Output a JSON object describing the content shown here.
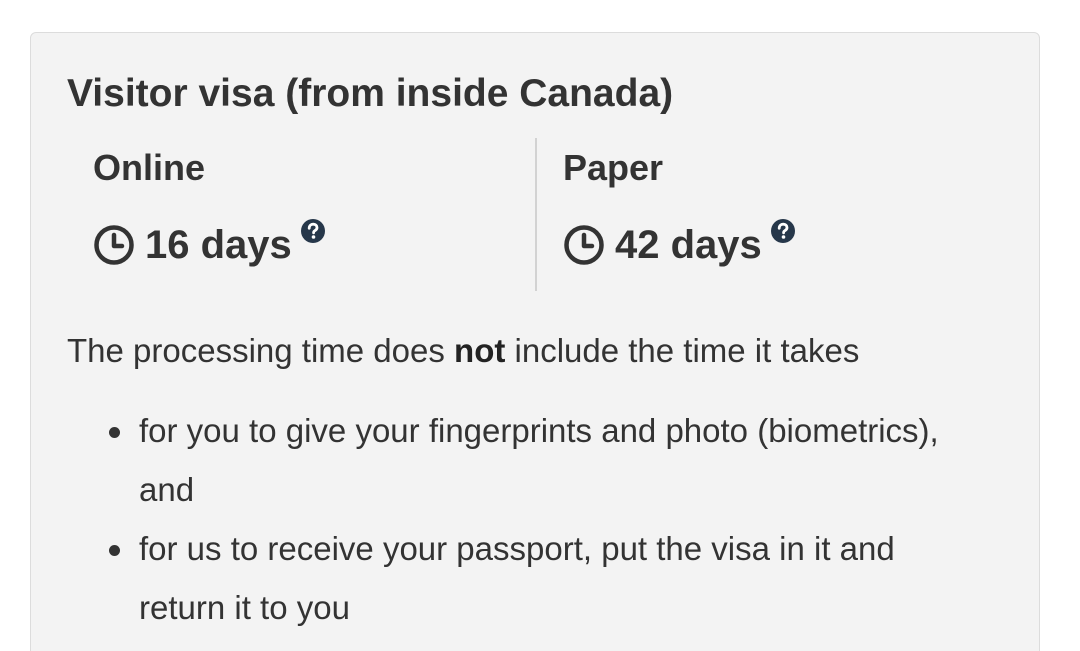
{
  "panel": {
    "title": "Visitor visa (from inside Canada)",
    "columns": [
      {
        "label": "Online",
        "clock_icon": "clock-icon",
        "days": "16 days",
        "help_icon": "question-circle-icon"
      },
      {
        "label": "Paper",
        "clock_icon": "clock-icon",
        "days": "42 days",
        "help_icon": "question-circle-icon"
      }
    ],
    "description": {
      "before": "The processing time does ",
      "emphasis": "not",
      "after": " include the time it takes"
    },
    "bullets": [
      "for you to give your fingerprints and photo (biometrics), and",
      "for us to receive your passport, put the visa in it and return it to you"
    ]
  },
  "colors": {
    "panel_background": "#f3f3f3",
    "panel_border": "#dcdcdc",
    "text": "#333333",
    "help_icon": "#26374a",
    "divider": "#d2d2d2"
  }
}
